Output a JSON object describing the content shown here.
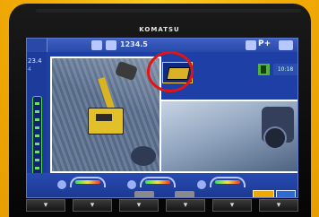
{
  "device": {
    "brand": "KOMATSU"
  },
  "display": {
    "top_value": "1234.5",
    "top_label": "P+",
    "left_value": "23.4",
    "left_value_small": "4",
    "time": "10:18"
  },
  "colors": {
    "panel_body": "#f2b40f",
    "screen_blue": "#1e3fa6",
    "highlight_red": "#e21313",
    "status_green": "#52b241",
    "machine_yellow": "#e2c02a",
    "button_orange": "#f0a800"
  },
  "icons": {
    "machine": "excavator-icon",
    "status": "status-icon",
    "meter": "gauge-icon"
  },
  "function_keys": [
    "▾",
    "▾",
    "▾",
    "▾",
    "▾",
    "▾"
  ]
}
